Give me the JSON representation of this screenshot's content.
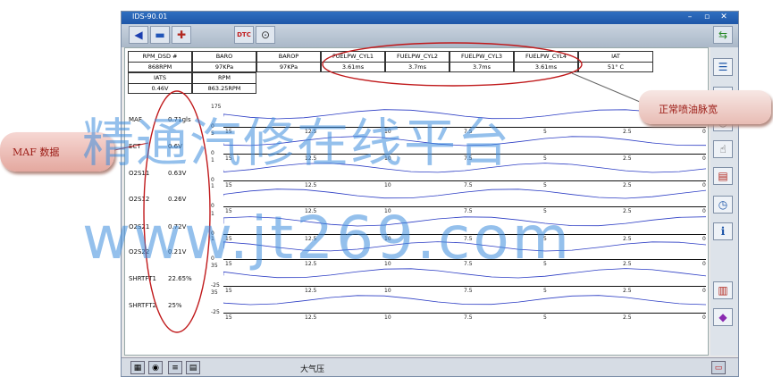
{
  "window": {
    "title": "IDS-90.01"
  },
  "toolbar": {
    "icons": [
      "back-arrow-icon",
      "car-icon",
      "tools-icon",
      "dtc-icon",
      "search-icon"
    ],
    "dtc_label": "DTC",
    "exit_icon": "exit-icon"
  },
  "pids_row1": [
    {
      "name": "RPM_DSD #",
      "value": "868RPM"
    },
    {
      "name": "BARO",
      "value": "97KPa"
    },
    {
      "name": "BAROP",
      "value": "97KPa"
    },
    {
      "name": "FUELPW_CYL1",
      "value": "3.61ms"
    },
    {
      "name": "FUELPW_CYL2",
      "value": "3.7ms"
    },
    {
      "name": "FUELPW_CYL3",
      "value": "3.7ms"
    },
    {
      "name": "FUELPW_CYL4",
      "value": "3.61ms"
    },
    {
      "name": "IAT",
      "value": "51° C"
    }
  ],
  "pids_row2": [
    {
      "name": "IATS",
      "value": "0.46V"
    },
    {
      "name": "RPM",
      "value": "863.25RPM"
    }
  ],
  "graph_rows": [
    {
      "label": "MAF",
      "value": "0.71gls",
      "top": "175",
      "bottom": "0"
    },
    {
      "label": "ECT",
      "value": "0.6V",
      "top": "5",
      "bottom": "0"
    },
    {
      "label": "O2S11",
      "value": "0.63V",
      "top": "1",
      "bottom": "0"
    },
    {
      "label": "O2S12",
      "value": "0.26V",
      "top": "1",
      "bottom": "0"
    },
    {
      "label": "O2S21",
      "value": "0.72V",
      "top": "1",
      "bottom": "0"
    },
    {
      "label": "O2S22",
      "value": "0.21V",
      "top": "1",
      "bottom": "0"
    },
    {
      "label": "SHRTFT1",
      "value": "22.65%",
      "top": "35",
      "bottom": "-25"
    },
    {
      "label": "SHRTFT2",
      "value": "25%",
      "top": "35",
      "bottom": "-25"
    }
  ],
  "x_ticks": [
    "15",
    "12.5",
    "10",
    "7.5",
    "5",
    "2.5",
    "0"
  ],
  "right_toolbar_icons": [
    "list-icon",
    "scroll-icon",
    "gauge-icon",
    "hand-pointer-icon",
    "table-icon",
    "stopwatch-icon",
    "info-icon",
    "chart-icon",
    "palette-icon"
  ],
  "status": {
    "text": "大气压"
  },
  "annotations": {
    "maf_label": "MAF 数据",
    "injection_label": "正常喷油脉宽"
  },
  "watermark": {
    "line1": "精通汽修在线平台",
    "line2": "www.jt269.com"
  },
  "colors": {
    "accent": "#1e56a8",
    "annotation_red": "#c0191b",
    "trace_blue": "#2b3cc4"
  }
}
